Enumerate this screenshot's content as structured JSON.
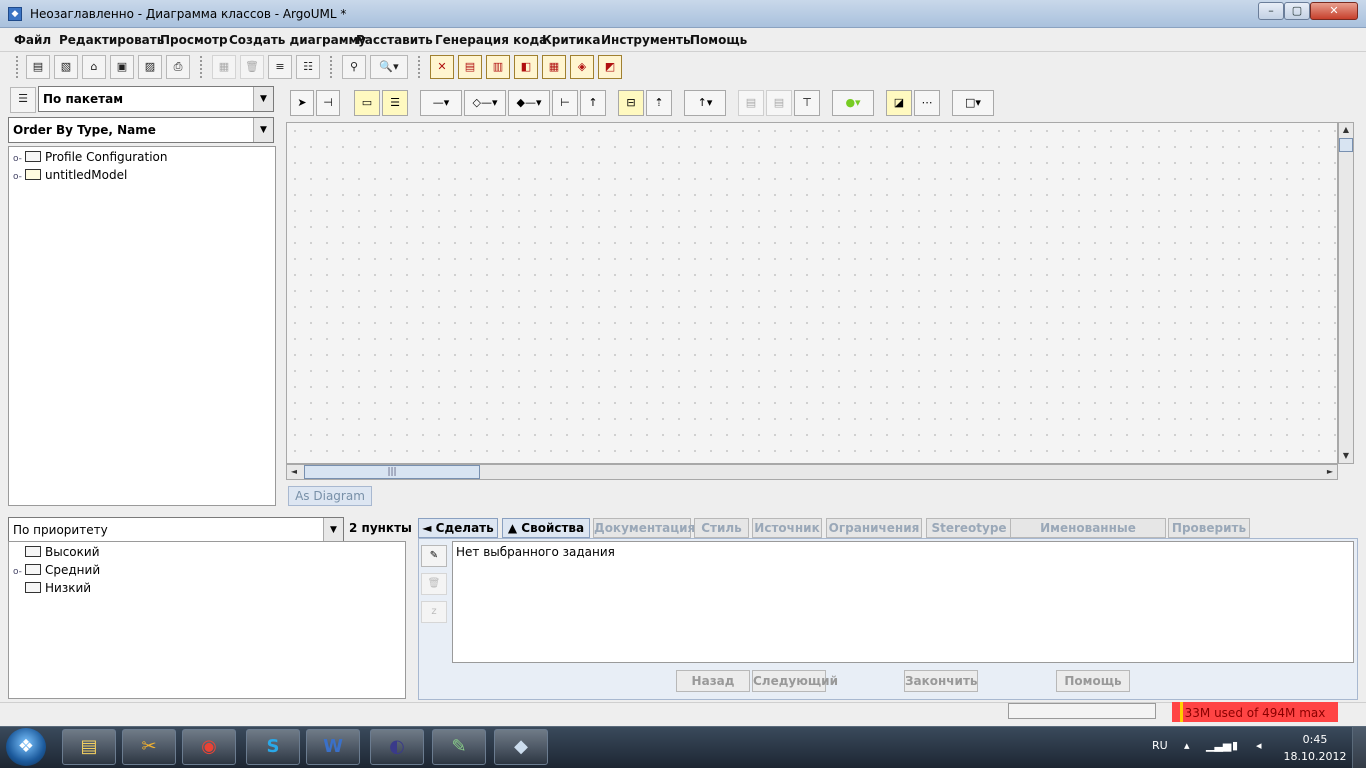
{
  "window": {
    "title": "Неозаглавленно - Диаграмма классов - ArgoUML *",
    "min": "–",
    "max": "▢",
    "close": "✕"
  },
  "menu": [
    "Файл",
    "Редактировать",
    "Просмотр",
    "Создать диаграмму",
    "Расставить",
    "Генерация кода",
    "Критика",
    "Инструменты",
    "Помощь"
  ],
  "navigator": {
    "perspective": "По пакетам",
    "order": "Order By Type, Name",
    "tree": [
      "Profile Configuration",
      "untitledModel"
    ]
  },
  "diagram": {
    "tab": "As Diagram"
  },
  "todo": {
    "sort": "По приоритету",
    "count": "2 пункты",
    "items": [
      "Высокий",
      "Средний",
      "Низкий"
    ]
  },
  "details": {
    "tabs": [
      "◄ Сделать",
      "▲ Свойства",
      "Документация",
      "Стиль",
      "Источник",
      "Ограничения",
      "Stereotype",
      "Именованные значения",
      "Проверить"
    ],
    "text": "Нет выбранного задания",
    "wizard": {
      "back": "Назад",
      "next": "Следующий",
      "finish": "Закончить",
      "help": "Помощь"
    }
  },
  "status": {
    "memory": "33M used of 494M max"
  },
  "taskbar": {
    "lang": "RU",
    "time": "0:45",
    "date": "18.10.2012",
    "word_label": "W"
  },
  "colors": {
    "memory_bar": "#ff4444",
    "note_yellow": "#fff9c0",
    "tab_active": "#dde6f2"
  }
}
